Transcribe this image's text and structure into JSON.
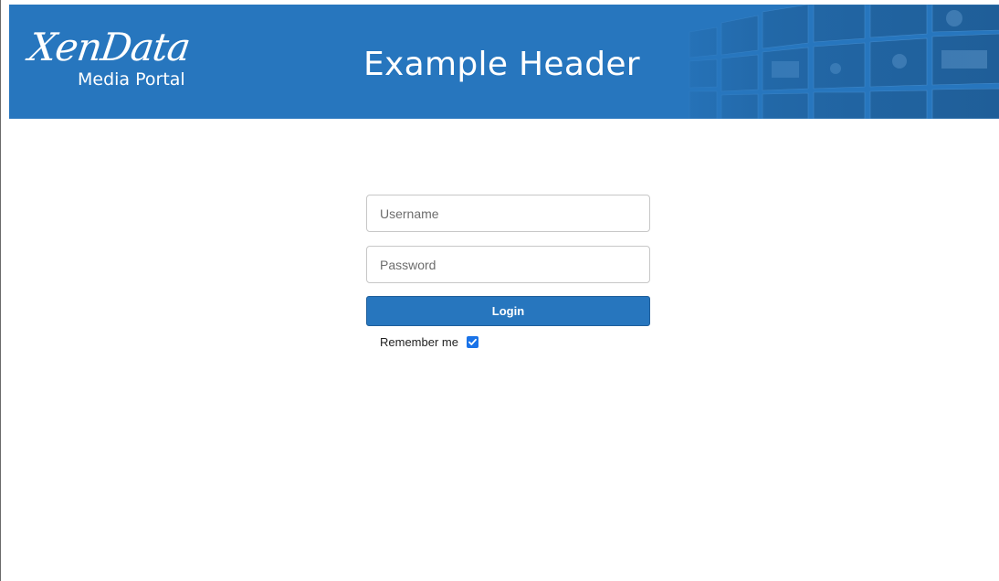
{
  "header": {
    "logo_main": "XenData",
    "logo_sub": "Media Portal",
    "title": "Example Header",
    "background_color": "#2776be"
  },
  "login": {
    "username_placeholder": "Username",
    "password_placeholder": "Password",
    "login_label": "Login",
    "remember_label": "Remember me",
    "remember_checked": true
  }
}
